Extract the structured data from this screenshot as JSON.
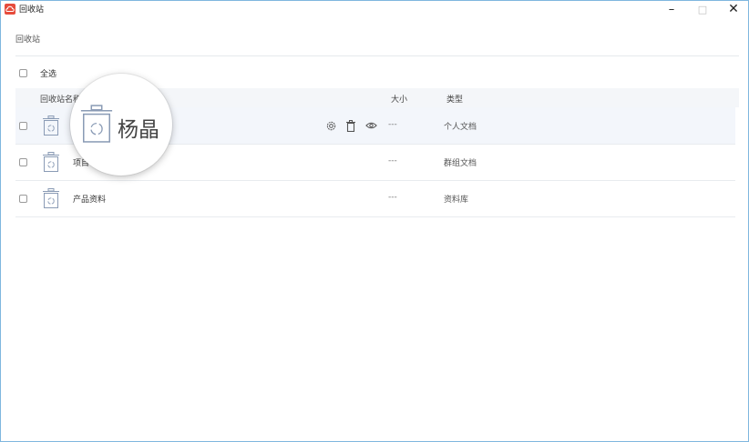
{
  "window": {
    "title": "回收站",
    "minimize_label": "–",
    "maximize_label": "□",
    "close_label": "✕",
    "app_icon": "cloud-app-icon"
  },
  "breadcrumb": "回收站",
  "select_all_label": "全选",
  "table": {
    "columns": {
      "name": "回收站名称",
      "size": "大小",
      "type": "类型"
    },
    "rows": [
      {
        "name": "杨晶",
        "size": "---",
        "type": "个人文档",
        "icon": "recycle-bin-icon"
      },
      {
        "name": "项目",
        "size": "---",
        "type": "群组文档",
        "icon": "recycle-bin-icon"
      },
      {
        "name": "产品资料",
        "size": "---",
        "type": "资料库",
        "icon": "recycle-bin-icon"
      }
    ],
    "row_actions": [
      "settings-icon",
      "trash-icon",
      "eye-icon"
    ]
  },
  "magnifier": {
    "name": "杨晶"
  },
  "colors": {
    "accent": "#e64c3c",
    "window_border": "#7fb7df",
    "header_bg": "#f4f6f9",
    "hover_row_bg": "#f3f6fb",
    "icon_color": "#8a9bb5"
  }
}
